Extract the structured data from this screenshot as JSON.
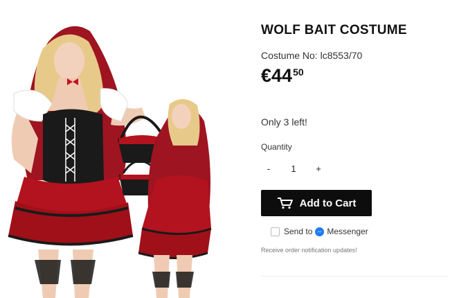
{
  "product": {
    "title": "WOLF BAIT COSTUME",
    "costume_no": "Costume No: lc8553/70",
    "price_whole": "€44",
    "price_cents": "50",
    "stock_text": "Only 3 left!",
    "quantity_label": "Quantity",
    "quantity_minus": "-",
    "quantity_value": "1",
    "quantity_plus": "+",
    "add_to_cart_label": "Add to Cart",
    "cart_icon": "cart-icon",
    "send_to_label": "Send to",
    "messenger_label": "Messenger",
    "messenger_icon": "messenger-icon",
    "notification_text": "Receive order notification updates!"
  },
  "colors": {
    "cart_button_bg": "#0d0d0d",
    "messenger_blue": "#1e7bf3",
    "costume_red": "#b3131e",
    "corset_black": "#1a1a1a"
  }
}
